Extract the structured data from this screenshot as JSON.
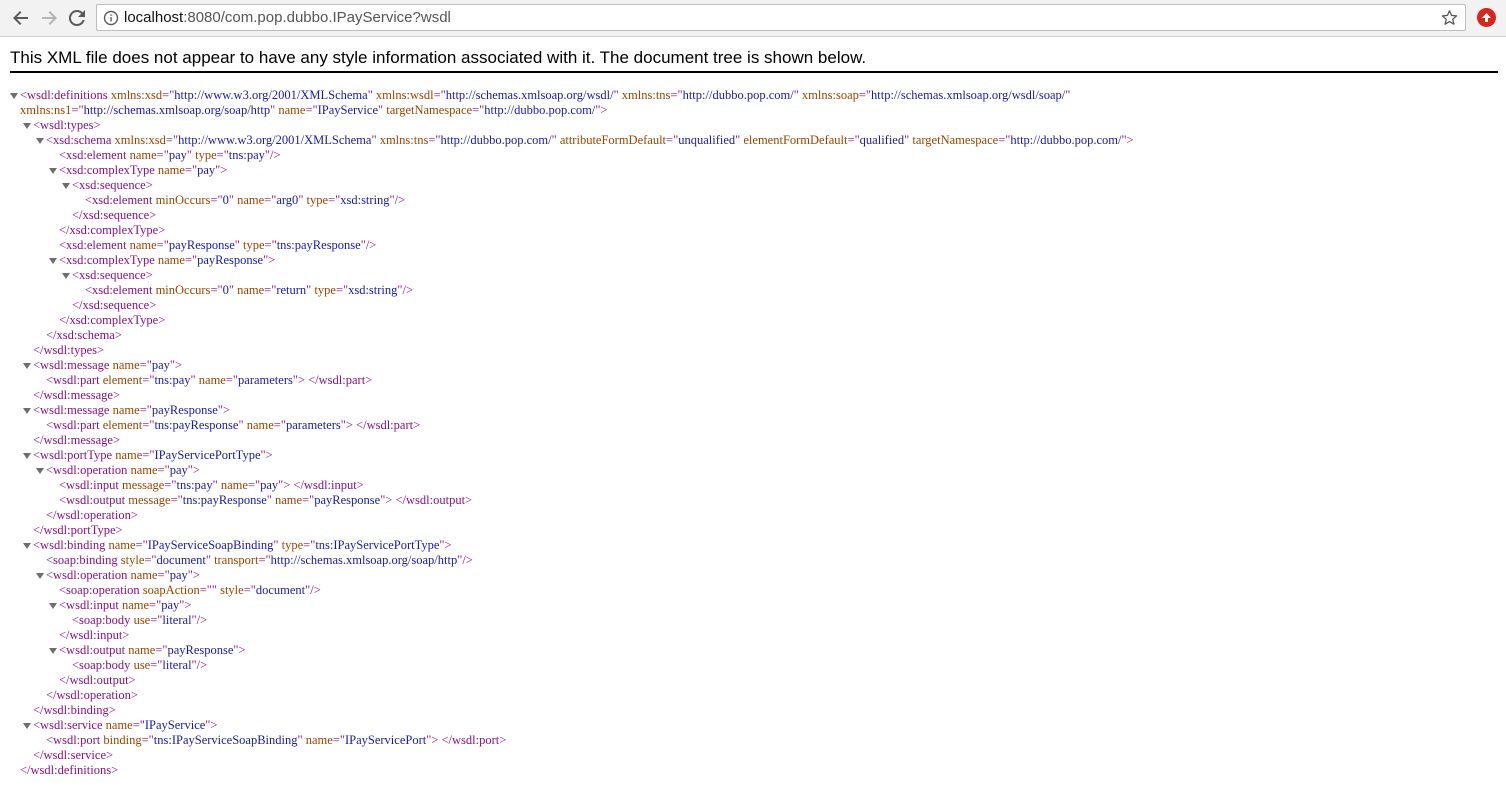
{
  "browser": {
    "url_host": "localhost",
    "url_rest": ":8080/com.pop.dubbo.IPayService?wsdl"
  },
  "info_banner": "This XML file does not appear to have any style information associated with it. The document tree is shown below.",
  "colors": {
    "tag": "#881280",
    "attr_name": "#994500",
    "attr_value": "#1a1aa6",
    "extension_icon": "#d9261c"
  },
  "xml_lines": [
    {
      "indent": 0,
      "arrow": true,
      "parts": [
        [
          "t",
          "<wsdl:definitions "
        ],
        [
          "an",
          "xmlns:xsd"
        ],
        [
          "t",
          "=\""
        ],
        [
          "av",
          "http://www.w3.org/2001/XMLSchema"
        ],
        [
          "t",
          "\" "
        ],
        [
          "an",
          "xmlns:wsdl"
        ],
        [
          "t",
          "=\""
        ],
        [
          "av",
          "http://schemas.xmlsoap.org/wsdl/"
        ],
        [
          "t",
          "\" "
        ],
        [
          "an",
          "xmlns:tns"
        ],
        [
          "t",
          "=\""
        ],
        [
          "av",
          "http://dubbo.pop.com/"
        ],
        [
          "t",
          "\" "
        ],
        [
          "an",
          "xmlns:soap"
        ],
        [
          "t",
          "=\""
        ],
        [
          "av",
          "http://schemas.xmlsoap.org/wsdl/soap/"
        ],
        [
          "t",
          "\""
        ]
      ]
    },
    {
      "indent": 0,
      "arrow": false,
      "parts": [
        [
          "an",
          "xmlns:ns1"
        ],
        [
          "t",
          "=\""
        ],
        [
          "av",
          "http://schemas.xmlsoap.org/soap/http"
        ],
        [
          "t",
          "\" "
        ],
        [
          "an",
          "name"
        ],
        [
          "t",
          "=\""
        ],
        [
          "av",
          "IPayService"
        ],
        [
          "t",
          "\" "
        ],
        [
          "an",
          "targetNamespace"
        ],
        [
          "t",
          "=\""
        ],
        [
          "av",
          "http://dubbo.pop.com/"
        ],
        [
          "t",
          "\">"
        ]
      ]
    },
    {
      "indent": 1,
      "arrow": true,
      "parts": [
        [
          "t",
          "<wsdl:types>"
        ]
      ]
    },
    {
      "indent": 2,
      "arrow": true,
      "parts": [
        [
          "t",
          "<xsd:schema "
        ],
        [
          "an",
          "xmlns:xsd"
        ],
        [
          "t",
          "=\""
        ],
        [
          "av",
          "http://www.w3.org/2001/XMLSchema"
        ],
        [
          "t",
          "\" "
        ],
        [
          "an",
          "xmlns:tns"
        ],
        [
          "t",
          "=\""
        ],
        [
          "av",
          "http://dubbo.pop.com/"
        ],
        [
          "t",
          "\" "
        ],
        [
          "an",
          "attributeFormDefault"
        ],
        [
          "t",
          "=\""
        ],
        [
          "av",
          "unqualified"
        ],
        [
          "t",
          "\" "
        ],
        [
          "an",
          "elementFormDefault"
        ],
        [
          "t",
          "=\""
        ],
        [
          "av",
          "qualified"
        ],
        [
          "t",
          "\" "
        ],
        [
          "an",
          "targetNamespace"
        ],
        [
          "t",
          "=\""
        ],
        [
          "av",
          "http://dubbo.pop.com/"
        ],
        [
          "t",
          "\">"
        ]
      ]
    },
    {
      "indent": 3,
      "arrow": false,
      "parts": [
        [
          "t",
          "<xsd:element "
        ],
        [
          "an",
          "name"
        ],
        [
          "t",
          "=\""
        ],
        [
          "av",
          "pay"
        ],
        [
          "t",
          "\" "
        ],
        [
          "an",
          "type"
        ],
        [
          "t",
          "=\""
        ],
        [
          "av",
          "tns:pay"
        ],
        [
          "t",
          "\"/>"
        ]
      ]
    },
    {
      "indent": 3,
      "arrow": true,
      "parts": [
        [
          "t",
          "<xsd:complexType "
        ],
        [
          "an",
          "name"
        ],
        [
          "t",
          "=\""
        ],
        [
          "av",
          "pay"
        ],
        [
          "t",
          "\">"
        ]
      ]
    },
    {
      "indent": 4,
      "arrow": true,
      "parts": [
        [
          "t",
          "<xsd:sequence>"
        ]
      ]
    },
    {
      "indent": 5,
      "arrow": false,
      "parts": [
        [
          "t",
          "<xsd:element "
        ],
        [
          "an",
          "minOccurs"
        ],
        [
          "t",
          "=\""
        ],
        [
          "av",
          "0"
        ],
        [
          "t",
          "\" "
        ],
        [
          "an",
          "name"
        ],
        [
          "t",
          "=\""
        ],
        [
          "av",
          "arg0"
        ],
        [
          "t",
          "\" "
        ],
        [
          "an",
          "type"
        ],
        [
          "t",
          "=\""
        ],
        [
          "av",
          "xsd:string"
        ],
        [
          "t",
          "\"/>"
        ]
      ]
    },
    {
      "indent": 4,
      "arrow": false,
      "parts": [
        [
          "t",
          "</xsd:sequence>"
        ]
      ]
    },
    {
      "indent": 3,
      "arrow": false,
      "parts": [
        [
          "t",
          "</xsd:complexType>"
        ]
      ]
    },
    {
      "indent": 3,
      "arrow": false,
      "parts": [
        [
          "t",
          "<xsd:element "
        ],
        [
          "an",
          "name"
        ],
        [
          "t",
          "=\""
        ],
        [
          "av",
          "payResponse"
        ],
        [
          "t",
          "\" "
        ],
        [
          "an",
          "type"
        ],
        [
          "t",
          "=\""
        ],
        [
          "av",
          "tns:payResponse"
        ],
        [
          "t",
          "\"/>"
        ]
      ]
    },
    {
      "indent": 3,
      "arrow": true,
      "parts": [
        [
          "t",
          "<xsd:complexType "
        ],
        [
          "an",
          "name"
        ],
        [
          "t",
          "=\""
        ],
        [
          "av",
          "payResponse"
        ],
        [
          "t",
          "\">"
        ]
      ]
    },
    {
      "indent": 4,
      "arrow": true,
      "parts": [
        [
          "t",
          "<xsd:sequence>"
        ]
      ]
    },
    {
      "indent": 5,
      "arrow": false,
      "parts": [
        [
          "t",
          "<xsd:element "
        ],
        [
          "an",
          "minOccurs"
        ],
        [
          "t",
          "=\""
        ],
        [
          "av",
          "0"
        ],
        [
          "t",
          "\" "
        ],
        [
          "an",
          "name"
        ],
        [
          "t",
          "=\""
        ],
        [
          "av",
          "return"
        ],
        [
          "t",
          "\" "
        ],
        [
          "an",
          "type"
        ],
        [
          "t",
          "=\""
        ],
        [
          "av",
          "xsd:string"
        ],
        [
          "t",
          "\"/>"
        ]
      ]
    },
    {
      "indent": 4,
      "arrow": false,
      "parts": [
        [
          "t",
          "</xsd:sequence>"
        ]
      ]
    },
    {
      "indent": 3,
      "arrow": false,
      "parts": [
        [
          "t",
          "</xsd:complexType>"
        ]
      ]
    },
    {
      "indent": 2,
      "arrow": false,
      "parts": [
        [
          "t",
          "</xsd:schema>"
        ]
      ]
    },
    {
      "indent": 1,
      "arrow": false,
      "parts": [
        [
          "t",
          "</wsdl:types>"
        ]
      ]
    },
    {
      "indent": 1,
      "arrow": true,
      "parts": [
        [
          "t",
          "<wsdl:message "
        ],
        [
          "an",
          "name"
        ],
        [
          "t",
          "=\""
        ],
        [
          "av",
          "pay"
        ],
        [
          "t",
          "\">"
        ]
      ]
    },
    {
      "indent": 2,
      "arrow": false,
      "parts": [
        [
          "t",
          "<wsdl:part "
        ],
        [
          "an",
          "element"
        ],
        [
          "t",
          "=\""
        ],
        [
          "av",
          "tns:pay"
        ],
        [
          "t",
          "\" "
        ],
        [
          "an",
          "name"
        ],
        [
          "t",
          "=\""
        ],
        [
          "av",
          "parameters"
        ],
        [
          "t",
          "\"> </wsdl:part>"
        ]
      ]
    },
    {
      "indent": 1,
      "arrow": false,
      "parts": [
        [
          "t",
          "</wsdl:message>"
        ]
      ]
    },
    {
      "indent": 1,
      "arrow": true,
      "parts": [
        [
          "t",
          "<wsdl:message "
        ],
        [
          "an",
          "name"
        ],
        [
          "t",
          "=\""
        ],
        [
          "av",
          "payResponse"
        ],
        [
          "t",
          "\">"
        ]
      ]
    },
    {
      "indent": 2,
      "arrow": false,
      "parts": [
        [
          "t",
          "<wsdl:part "
        ],
        [
          "an",
          "element"
        ],
        [
          "t",
          "=\""
        ],
        [
          "av",
          "tns:payResponse"
        ],
        [
          "t",
          "\" "
        ],
        [
          "an",
          "name"
        ],
        [
          "t",
          "=\""
        ],
        [
          "av",
          "parameters"
        ],
        [
          "t",
          "\"> </wsdl:part>"
        ]
      ]
    },
    {
      "indent": 1,
      "arrow": false,
      "parts": [
        [
          "t",
          "</wsdl:message>"
        ]
      ]
    },
    {
      "indent": 1,
      "arrow": true,
      "parts": [
        [
          "t",
          "<wsdl:portType "
        ],
        [
          "an",
          "name"
        ],
        [
          "t",
          "=\""
        ],
        [
          "av",
          "IPayServicePortType"
        ],
        [
          "t",
          "\">"
        ]
      ]
    },
    {
      "indent": 2,
      "arrow": true,
      "parts": [
        [
          "t",
          "<wsdl:operation "
        ],
        [
          "an",
          "name"
        ],
        [
          "t",
          "=\""
        ],
        [
          "av",
          "pay"
        ],
        [
          "t",
          "\">"
        ]
      ]
    },
    {
      "indent": 3,
      "arrow": false,
      "parts": [
        [
          "t",
          "<wsdl:input "
        ],
        [
          "an",
          "message"
        ],
        [
          "t",
          "=\""
        ],
        [
          "av",
          "tns:pay"
        ],
        [
          "t",
          "\" "
        ],
        [
          "an",
          "name"
        ],
        [
          "t",
          "=\""
        ],
        [
          "av",
          "pay"
        ],
        [
          "t",
          "\"> </wsdl:input>"
        ]
      ]
    },
    {
      "indent": 3,
      "arrow": false,
      "parts": [
        [
          "t",
          "<wsdl:output "
        ],
        [
          "an",
          "message"
        ],
        [
          "t",
          "=\""
        ],
        [
          "av",
          "tns:payResponse"
        ],
        [
          "t",
          "\" "
        ],
        [
          "an",
          "name"
        ],
        [
          "t",
          "=\""
        ],
        [
          "av",
          "payResponse"
        ],
        [
          "t",
          "\"> </wsdl:output>"
        ]
      ]
    },
    {
      "indent": 2,
      "arrow": false,
      "parts": [
        [
          "t",
          "</wsdl:operation>"
        ]
      ]
    },
    {
      "indent": 1,
      "arrow": false,
      "parts": [
        [
          "t",
          "</wsdl:portType>"
        ]
      ]
    },
    {
      "indent": 1,
      "arrow": true,
      "parts": [
        [
          "t",
          "<wsdl:binding "
        ],
        [
          "an",
          "name"
        ],
        [
          "t",
          "=\""
        ],
        [
          "av",
          "IPayServiceSoapBinding"
        ],
        [
          "t",
          "\" "
        ],
        [
          "an",
          "type"
        ],
        [
          "t",
          "=\""
        ],
        [
          "av",
          "tns:IPayServicePortType"
        ],
        [
          "t",
          "\">"
        ]
      ]
    },
    {
      "indent": 2,
      "arrow": false,
      "parts": [
        [
          "t",
          "<soap:binding "
        ],
        [
          "an",
          "style"
        ],
        [
          "t",
          "=\""
        ],
        [
          "av",
          "document"
        ],
        [
          "t",
          "\" "
        ],
        [
          "an",
          "transport"
        ],
        [
          "t",
          "=\""
        ],
        [
          "av",
          "http://schemas.xmlsoap.org/soap/http"
        ],
        [
          "t",
          "\"/>"
        ]
      ]
    },
    {
      "indent": 2,
      "arrow": true,
      "parts": [
        [
          "t",
          "<wsdl:operation "
        ],
        [
          "an",
          "name"
        ],
        [
          "t",
          "=\""
        ],
        [
          "av",
          "pay"
        ],
        [
          "t",
          "\">"
        ]
      ]
    },
    {
      "indent": 3,
      "arrow": false,
      "parts": [
        [
          "t",
          "<soap:operation "
        ],
        [
          "an",
          "soapAction"
        ],
        [
          "t",
          "=\"\" "
        ],
        [
          "an",
          "style"
        ],
        [
          "t",
          "=\""
        ],
        [
          "av",
          "document"
        ],
        [
          "t",
          "\"/>"
        ]
      ]
    },
    {
      "indent": 3,
      "arrow": true,
      "parts": [
        [
          "t",
          "<wsdl:input "
        ],
        [
          "an",
          "name"
        ],
        [
          "t",
          "=\""
        ],
        [
          "av",
          "pay"
        ],
        [
          "t",
          "\">"
        ]
      ]
    },
    {
      "indent": 4,
      "arrow": false,
      "parts": [
        [
          "t",
          "<soap:body "
        ],
        [
          "an",
          "use"
        ],
        [
          "t",
          "=\""
        ],
        [
          "av",
          "literal"
        ],
        [
          "t",
          "\"/>"
        ]
      ]
    },
    {
      "indent": 3,
      "arrow": false,
      "parts": [
        [
          "t",
          "</wsdl:input>"
        ]
      ]
    },
    {
      "indent": 3,
      "arrow": true,
      "parts": [
        [
          "t",
          "<wsdl:output "
        ],
        [
          "an",
          "name"
        ],
        [
          "t",
          "=\""
        ],
        [
          "av",
          "payResponse"
        ],
        [
          "t",
          "\">"
        ]
      ]
    },
    {
      "indent": 4,
      "arrow": false,
      "parts": [
        [
          "t",
          "<soap:body "
        ],
        [
          "an",
          "use"
        ],
        [
          "t",
          "=\""
        ],
        [
          "av",
          "literal"
        ],
        [
          "t",
          "\"/>"
        ]
      ]
    },
    {
      "indent": 3,
      "arrow": false,
      "parts": [
        [
          "t",
          "</wsdl:output>"
        ]
      ]
    },
    {
      "indent": 2,
      "arrow": false,
      "parts": [
        [
          "t",
          "</wsdl:operation>"
        ]
      ]
    },
    {
      "indent": 1,
      "arrow": false,
      "parts": [
        [
          "t",
          "</wsdl:binding>"
        ]
      ]
    },
    {
      "indent": 1,
      "arrow": true,
      "parts": [
        [
          "t",
          "<wsdl:service "
        ],
        [
          "an",
          "name"
        ],
        [
          "t",
          "=\""
        ],
        [
          "av",
          "IPayService"
        ],
        [
          "t",
          "\">"
        ]
      ]
    },
    {
      "indent": 2,
      "arrow": false,
      "parts": [
        [
          "t",
          "<wsdl:port "
        ],
        [
          "an",
          "binding"
        ],
        [
          "t",
          "=\""
        ],
        [
          "av",
          "tns:IPayServiceSoapBinding"
        ],
        [
          "t",
          "\" "
        ],
        [
          "an",
          "name"
        ],
        [
          "t",
          "=\""
        ],
        [
          "av",
          "IPayServicePort"
        ],
        [
          "t",
          "\"> </wsdl:port>"
        ]
      ]
    },
    {
      "indent": 1,
      "arrow": false,
      "parts": [
        [
          "t",
          "</wsdl:service>"
        ]
      ]
    },
    {
      "indent": 0,
      "arrow": false,
      "parts": [
        [
          "t",
          "</wsdl:definitions>"
        ]
      ]
    }
  ]
}
